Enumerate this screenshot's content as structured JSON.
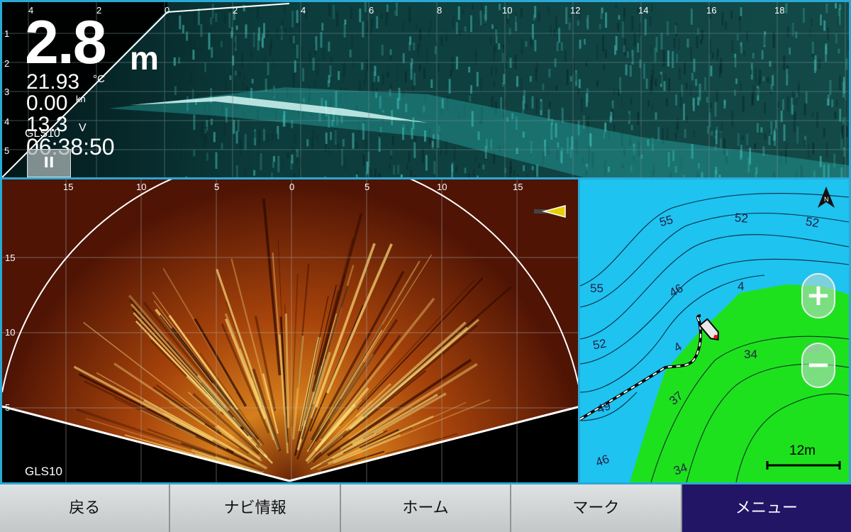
{
  "colors": {
    "frame": "#29a9d6",
    "sonar_top_tint": "#2fc7c0",
    "sonar_fan_low": "#4a1204",
    "sonar_fan_high": "#ffe680",
    "map_water": "#1ec3f0",
    "map_land": "#1ee11e",
    "nav_active": "#221566"
  },
  "top_sonar": {
    "x_ticks": [
      "4",
      "2",
      "0",
      "2",
      "4",
      "6",
      "8",
      "10",
      "12",
      "14",
      "16",
      "18"
    ],
    "y_ticks": [
      "1",
      "2",
      "3",
      "4",
      "5"
    ],
    "depth": "2.8",
    "depth_unit": "m",
    "temperature": "21.93",
    "temperature_unit": "°C",
    "speed": "0.00",
    "speed_unit": "kn",
    "voltage": "13.3",
    "voltage_unit": "V",
    "source": "GLS10",
    "clock": "06:38:50",
    "pause_label": "II"
  },
  "fan_sonar": {
    "x_ticks": [
      "15",
      "10",
      "5",
      "0",
      "5",
      "10",
      "15"
    ],
    "y_ticks": [
      "15",
      "10",
      "5"
    ],
    "source": "GLS10",
    "direction_icon": "transducer-direction-icon"
  },
  "map": {
    "north_label": "N",
    "zoom_in_label": "+",
    "zoom_out_label": "−",
    "scale_label": "12m",
    "contour_labels": [
      "55",
      "52",
      "52",
      "55",
      "46",
      "4",
      "52",
      "4",
      "34",
      "34",
      "37",
      "49",
      "46",
      "34"
    ]
  },
  "nav": {
    "back": "戻る",
    "navi_info": "ナビ情報",
    "home": "ホーム",
    "mark": "マーク",
    "menu": "メニュー"
  }
}
